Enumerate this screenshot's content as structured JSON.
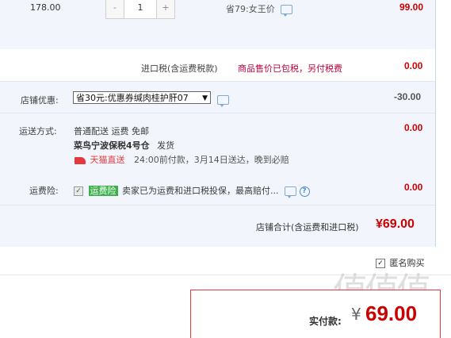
{
  "item": {
    "unit_price": "178.00",
    "quantity": "1",
    "minus_label": "-",
    "plus_label": "+",
    "discount_note": "省79:女王价",
    "subtotal": "99.00"
  },
  "import_tax": {
    "label": "进口税(含运费税款)",
    "note": "商品售价已包税，另付税费",
    "amount": "0.00"
  },
  "shop_discount": {
    "label": "店铺优惠:",
    "selected": "省30元:优惠券缄肉桂护肝07",
    "amount": "-30.00"
  },
  "shipping": {
    "label": "运送方式:",
    "method": "普通配送 运费 免邮",
    "warehouse": "菜鸟宁波保税4号仓",
    "dispatch": "发货",
    "service_tag": "天猫直送",
    "delivery_promise": "24:00前付款，3月14日送达，晚到必赔",
    "amount": "0.00"
  },
  "insurance": {
    "label": "运费险:",
    "tag": "运费险",
    "text": "卖家已为运费和进口税投保，最高赔付...",
    "amount": "0.00"
  },
  "shop_total": {
    "label": "店铺合计(含运费和进口税)",
    "amount": "¥69.00"
  },
  "anonymous": {
    "label": "匿名购买",
    "checked": true
  },
  "payment": {
    "label": "实付款:",
    "currency": "¥",
    "amount": "69.00"
  },
  "watermark": "值值值",
  "colors": {
    "price_red": "#cc0000",
    "panel_bg": "#f2f6fc",
    "tag_green": "#3bb04a",
    "tmall_red": "#e4393c"
  }
}
